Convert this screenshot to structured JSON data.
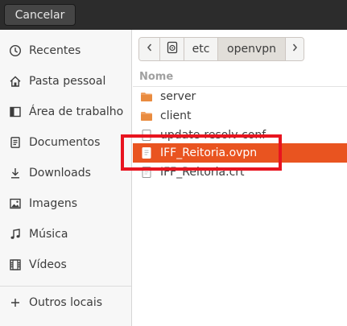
{
  "header": {
    "cancel_label": "Cancelar"
  },
  "sidebar": {
    "items": [
      {
        "label": "Recentes",
        "icon": "clock-icon"
      },
      {
        "label": "Pasta pessoal",
        "icon": "home-icon"
      },
      {
        "label": "Área de trabalho",
        "icon": "desktop-icon"
      },
      {
        "label": "Documentos",
        "icon": "document-icon"
      },
      {
        "label": "Downloads",
        "icon": "download-icon"
      },
      {
        "label": "Imagens",
        "icon": "image-icon"
      },
      {
        "label": "Música",
        "icon": "music-icon"
      },
      {
        "label": "Vídeos",
        "icon": "video-icon"
      },
      {
        "label": "Outros locais",
        "icon": "plus-icon"
      }
    ]
  },
  "pathbar": {
    "segments": [
      "etc",
      "openvpn"
    ],
    "active": "openvpn"
  },
  "filelist": {
    "column_name": "Nome",
    "files": [
      {
        "name": "server",
        "type": "folder"
      },
      {
        "name": "client",
        "type": "folder"
      },
      {
        "name": "update-resolv-conf",
        "type": "file"
      },
      {
        "name": "IFF_Reitoria.ovpn",
        "type": "file",
        "selected": true
      },
      {
        "name": "IFF_Reitoria.crt",
        "type": "file"
      }
    ]
  },
  "colors": {
    "accent": "#e95420",
    "highlight": "#e8141f",
    "folder": "#f0a060"
  }
}
